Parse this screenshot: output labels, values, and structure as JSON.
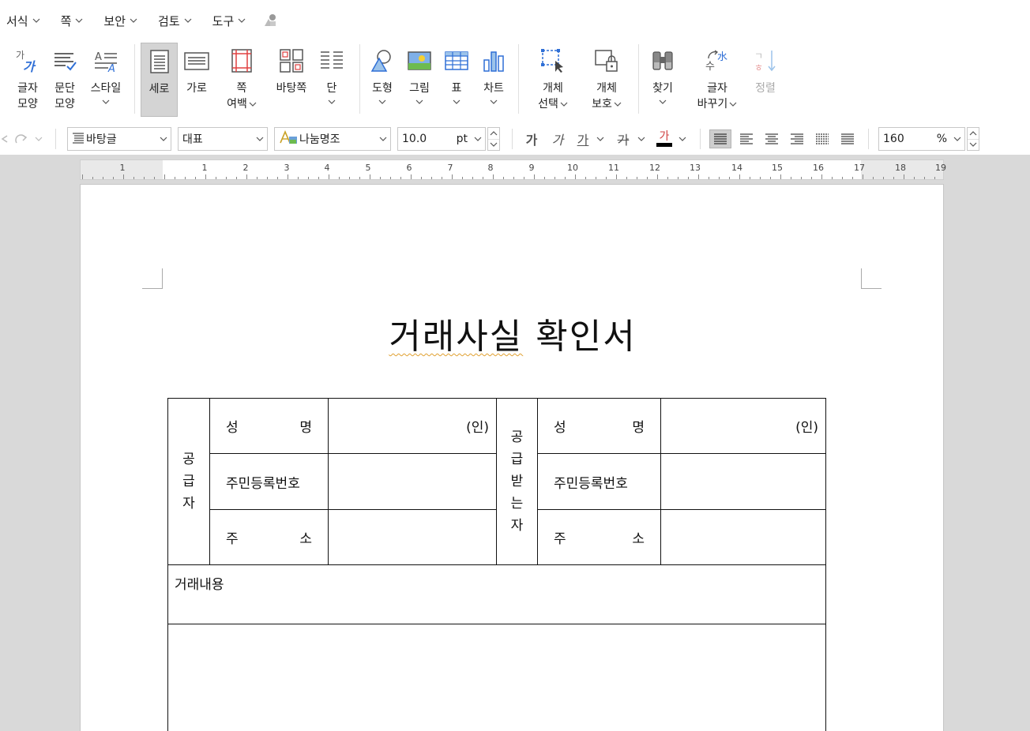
{
  "menu": [
    {
      "label": "서식"
    },
    {
      "label": "쪽"
    },
    {
      "label": "보안"
    },
    {
      "label": "검토"
    },
    {
      "label": "도구"
    }
  ],
  "ribbon": {
    "char_shape": {
      "l1": "글자",
      "l2": "모양"
    },
    "para_shape": {
      "l1": "문단",
      "l2": "모양"
    },
    "style": {
      "l1": "스타일"
    },
    "portrait": {
      "l1": "세로"
    },
    "landscape": {
      "l1": "가로"
    },
    "page_margin": {
      "l1": "쪽",
      "l2": "여백"
    },
    "master_page": {
      "l1": "바탕쪽"
    },
    "columns": {
      "l1": "단"
    },
    "shape": {
      "l1": "도형"
    },
    "picture": {
      "l1": "그림"
    },
    "table": {
      "l1": "표"
    },
    "chart": {
      "l1": "차트"
    },
    "object_select": {
      "l1": "개체",
      "l2": "선택"
    },
    "object_protect": {
      "l1": "개체",
      "l2": "보호"
    },
    "find": {
      "l1": "찾기"
    },
    "char_replace": {
      "l1": "글자",
      "l2": "바꾸기"
    },
    "sort": {
      "l1": "정렬"
    }
  },
  "format": {
    "style": "바탕글",
    "font_lang": "대표",
    "font": "나눔명조",
    "size": "10.0",
    "unit": "pt",
    "zoom": "160",
    "zoom_unit": "%",
    "bold": "가",
    "italic": "가",
    "underline": "가",
    "strike": "가",
    "color": "가"
  },
  "ruler": {
    "labels": [
      "1",
      "1",
      "2",
      "3",
      "4",
      "5",
      "6",
      "7",
      "8",
      "9",
      "10",
      "11",
      "12",
      "13",
      "14",
      "15",
      "16",
      "17",
      "18",
      "19"
    ]
  },
  "document": {
    "title_a": "거래사실",
    "title_b": "확인서",
    "supplier": [
      "공",
      "급",
      "자"
    ],
    "receiver": [
      "공",
      "급",
      "받",
      "는",
      "자"
    ],
    "name_a": "성",
    "name_b": "명",
    "seal": "(인)",
    "id_number": "주민등록번호",
    "addr_a": "주",
    "addr_b": "소",
    "content_header": "거래내용"
  },
  "colors": {
    "accent_blue": "#2f6fd6",
    "workspace_bg": "#d9d9d9",
    "selected_btn": "#d4d4d4",
    "spell_underline": "#e0a030"
  }
}
